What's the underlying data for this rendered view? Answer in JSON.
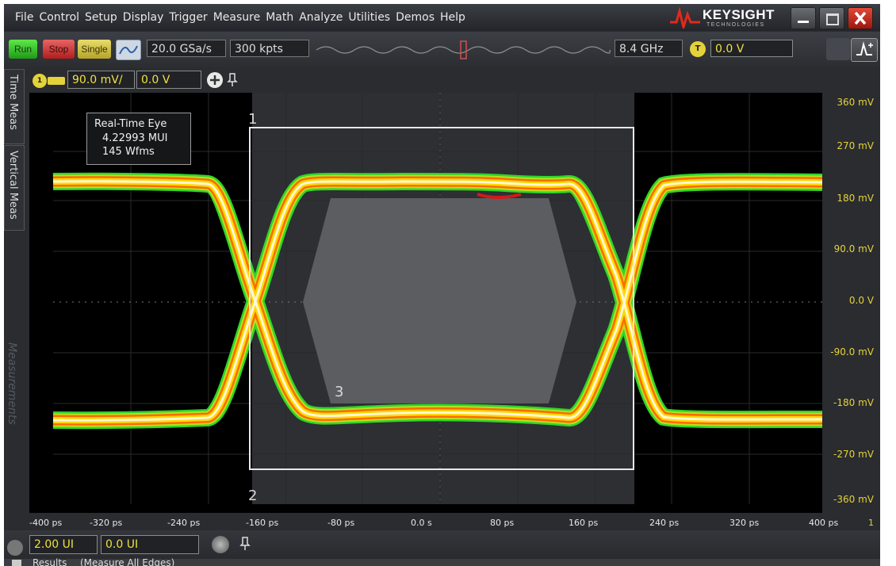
{
  "menu": [
    "File",
    "Control",
    "Setup",
    "Display",
    "Trigger",
    "Measure",
    "Math",
    "Analyze",
    "Utilities",
    "Demos",
    "Help"
  ],
  "brand": {
    "name": "KEYSIGHT",
    "sub": "TECHNOLOGIES"
  },
  "toolbar": {
    "run_label": "Run",
    "stop_label": "Stop",
    "single_label": "Single",
    "sample_rate": "20.0 GSa/s",
    "memory_depth": "300 kpts",
    "bandwidth": "8.4 GHz",
    "trigger_badge": "T",
    "trigger_level": "0.0 V"
  },
  "channel": {
    "badge": "1",
    "scale": "90.0 mV/",
    "offset": "0.0 V"
  },
  "left_tabs": {
    "time_meas": "Time Meas",
    "vertical_meas": "Vertical Meas",
    "measurements": "Measurements"
  },
  "eye_info": {
    "title": "Real-Time Eye",
    "mui": "4.22993 MUI",
    "wfms": "145 Wfms"
  },
  "markers": {
    "m1": "1",
    "m2": "2",
    "m3": "3"
  },
  "y_axis": [
    "360 mV",
    "270 mV",
    "180 mV",
    "90.0 mV",
    "0.0 V",
    "-90.0 mV",
    "-180 mV",
    "-270 mV",
    "-360 mV"
  ],
  "x_axis": [
    "-400 ps",
    "-320 ps",
    "-240 ps",
    "-160 ps",
    "-80 ps",
    "0.0 s",
    "80 ps",
    "160 ps",
    "240 ps",
    "320 ps",
    "400 ps"
  ],
  "x_axis_end_badge": "1",
  "timebase": {
    "scale": "2.00 UI",
    "position": "0.0 UI"
  },
  "results": {
    "label": "Results",
    "detail": "(Measure All Edges)"
  },
  "colors": {
    "trace_core": "#fff7d8",
    "trace_yellow": "#ffd800",
    "trace_orange": "#ff6a00",
    "trace_green": "#2fd62a",
    "accent": "#e4d23a",
    "close": "#c8281a"
  }
}
